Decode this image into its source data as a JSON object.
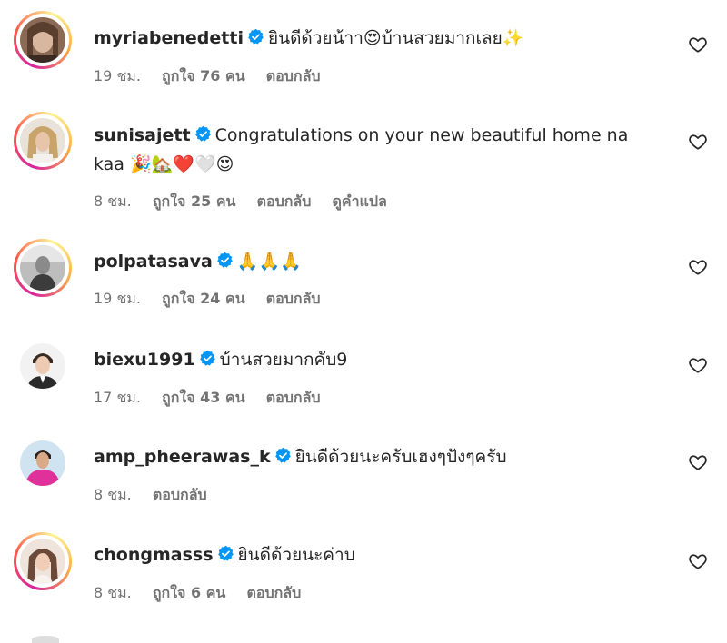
{
  "comments": [
    {
      "username": "myriabenedetti",
      "verified": true,
      "text": "ยินดีด้วยน้าา",
      "text_after": "บ้านสวยมากเลย",
      "emojis_mid": "😍",
      "emojis_end": "✨",
      "time": "19 ชม.",
      "likes": "ถูกใจ 76 คน",
      "reply": "ตอบกลับ",
      "has_story_ring": true
    },
    {
      "username": "sunisajett",
      "verified": true,
      "text": "Congratulations on your new beautiful home na",
      "text_line2": "kaa",
      "emojis_end": "🎉🏡❤️🤍😍",
      "time": "8 ชม.",
      "likes": "ถูกใจ 25 คน",
      "reply": "ตอบกลับ",
      "translate": "ดูคำแปล",
      "has_story_ring": true
    },
    {
      "username": "polpatasava",
      "verified": true,
      "emojis_end": "🙏🙏🙏",
      "time": "19 ชม.",
      "likes": "ถูกใจ 24 คน",
      "reply": "ตอบกลับ",
      "has_story_ring": true
    },
    {
      "username": "biexu1991",
      "verified": true,
      "text": "บ้านสวยมากคับ9",
      "time": "17 ชม.",
      "likes": "ถูกใจ 43 คน",
      "reply": "ตอบกลับ",
      "has_story_ring": false
    },
    {
      "username": "amp_pheerawas_k",
      "verified": true,
      "text": "ยินดีด้วยนะครับเฮงๆปังๆครับ",
      "time": "8 ชม.",
      "reply": "ตอบกลับ",
      "has_story_ring": false
    },
    {
      "username": "chongmasss",
      "verified": true,
      "text": "ยินดีด้วยนะค่าบ",
      "time": "8 ชม.",
      "likes": "ถูกใจ 6 คน",
      "reply": "ตอบกลับ",
      "has_story_ring": true
    }
  ],
  "icons": {
    "verified": "verified-badge-icon",
    "like": "heart-outline-icon"
  },
  "colors": {
    "verified_blue": "#0095f6",
    "meta_gray": "#737373",
    "text": "#262626"
  }
}
